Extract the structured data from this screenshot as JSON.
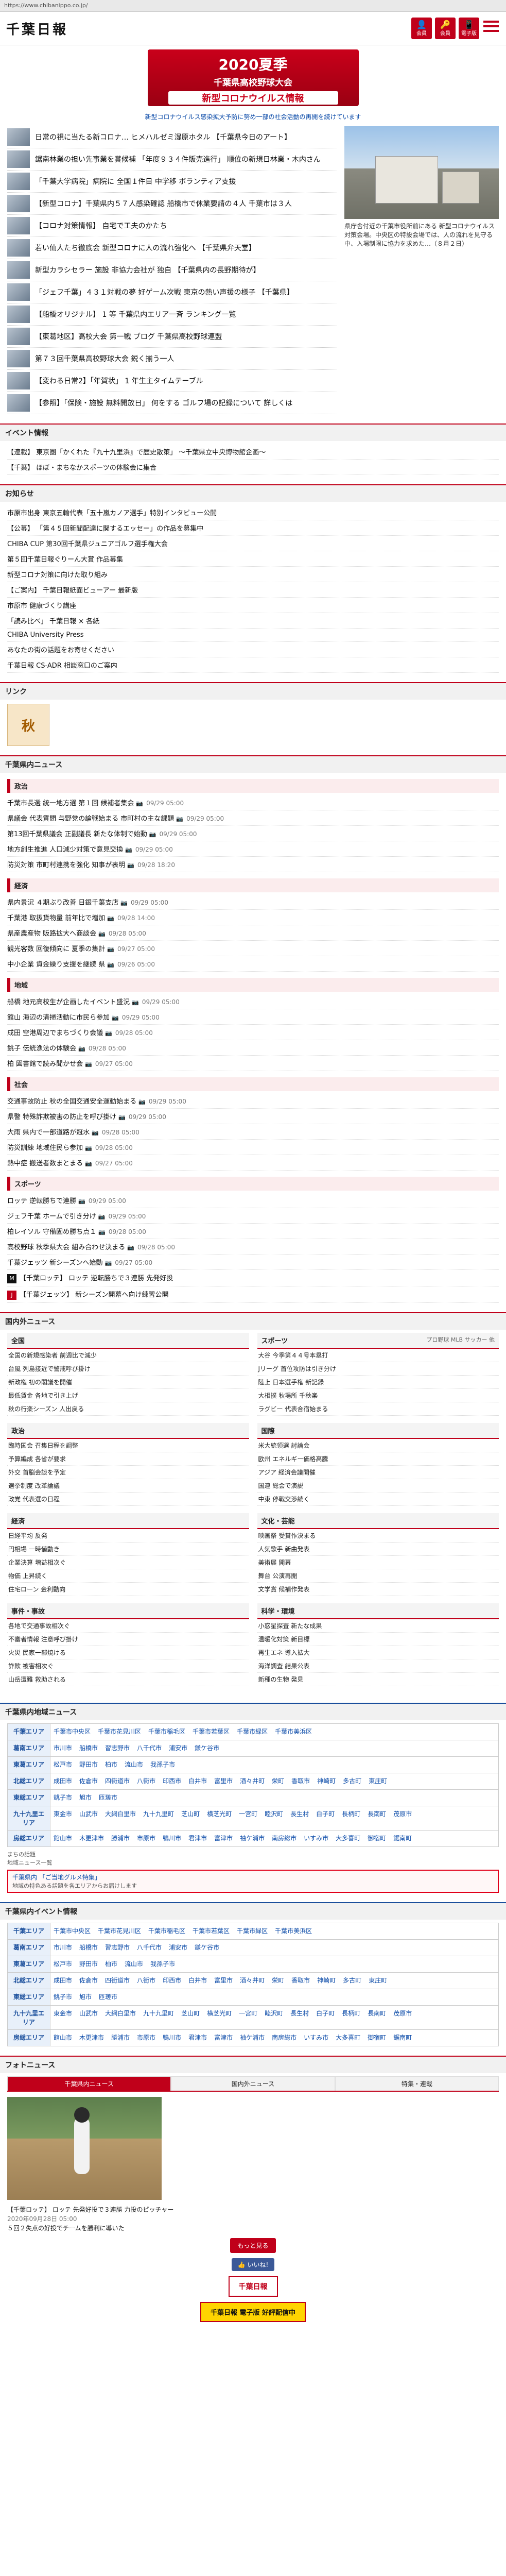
{
  "url": "https://www.chibanippo.co.jp/",
  "header": {
    "logo": "千葉日報",
    "icons": [
      {
        "label": "会員",
        "glyph": "👤",
        "color": "#c0001a"
      },
      {
        "label": "会員",
        "glyph": "🔑",
        "color": "#c0001a"
      },
      {
        "label": "電子版",
        "glyph": "📱",
        "color": "#c0001a"
      }
    ]
  },
  "banner": {
    "line1": "2020夏季",
    "line2": "千葉県高校野球大会",
    "line3": "新型コロナウイルス情報"
  },
  "notice": "新型コロナウイルス感染拡大予防に努め一部の社会活動の再開を続けています",
  "top_news": [
    "日常の視に当たる新コロナ… ヒメハルゼミ湿原ホタル 【千葉県今日のアート】",
    "鋸南林業の担い先事業を賞候補 「年度９３４件販売進行」 順位の新規日林業・木内さん",
    "「千葉大学病院」病院に 全国１件目 中学移 ボランティア支援",
    "【新型コロナ】千葉県内５７人感染確認 船橋市で休業要請の４人 千葉市は３人",
    "【コロナ対策情報】 自宅で工夫のかたち",
    "若い仙人たち徹底会 新型コロナに人の流れ強化へ 【千葉県弁天堂】",
    "新型カラシセラー 施設 非協力会社が 独自 【千葉県内の長野期待が】",
    "「ジェフ千葉」４３１対戦の夢 好ゲーム次戦 東京の熱い声援の様子 【千葉県】",
    "【船橋オリジナル】 1 等 千葉県内エリア一斉 ランキング一覧",
    "【東葛地区】高校大会 第一戦 ブログ 千葉県高校野球連盟",
    "第７３回千葉県高校野球大会 鋭く揃う一人",
    "【変わる日常2】「年賀状」 1 年生主タイムテーブル",
    "【参照】「保険・施設 無料開放日」 何をする ゴルフ場の記録について 詳しくは"
  ],
  "top_photo_caption": "県庁舎付近の千葉市役所前にある 新型コロナウイルス対策会場。中央区の特設会場では、人の流れを見守る中、入場制限に協力を求めた…（８月２日）",
  "sections": {
    "events_title": "イベント情報",
    "events": [
      "【連載】 東京圏「かくれた『九十九里浜』で歴史散策」 〜千葉県立中央博物館企画〜",
      "【千葉】 ほぼ・まちなかスポーツの体験会に集合"
    ],
    "oshirase_title": "お知らせ",
    "oshirase": [
      "市原市出身 東京五輪代表「五十嵐カノア選手」特別インタビュー公開",
      "【公募】 「第４５回新聞配達に関するエッセー」の作品を募集中",
      "CHIBA CUP 第30回千葉県ジュニアゴルフ選手権大会",
      "第５回千葉日報ぐりーん大賞 作品募集",
      "新型コロナ対策に向けた取り組み",
      "【ご案内】 千葉日報紙面ビューアー 最新版",
      "市原市 健康づくり講座",
      "「読み比べ」 千葉日報 × 各紙",
      "CHIBA University Press",
      "あなたの街の話題をお寄せください",
      "千葉日報 CS-ADR 相談窓口のご案内"
    ],
    "links_title": "リンク",
    "links_ad_text": "秋",
    "local_news_title": "千葉県内ニュース",
    "categories": [
      {
        "name": "政治",
        "items": [
          {
            "t": "千葉市長選 統一地方選 第１回 候補者集会",
            "d": "09/29 05:00"
          },
          {
            "t": "県議会 代表質問 与野党の論戦始まる 市町村の主な課題",
            "d": "09/29 05:00"
          },
          {
            "t": "第13回千葉県議会 正副議長 新たな体制で始動",
            "d": "09/29 05:00"
          },
          {
            "t": "地方創生推進 人口減少対策で意見交換",
            "d": "09/29 05:00"
          },
          {
            "t": "防災対策 市町村連携を強化 知事が表明",
            "d": "09/28 18:20"
          }
        ]
      },
      {
        "name": "経済",
        "items": [
          {
            "t": "県内景況 ４期ぶり改善 日銀千葉支店",
            "d": "09/29 05:00"
          },
          {
            "t": "千葉港 取扱貨物量 前年比で増加",
            "d": "09/28 14:00"
          },
          {
            "t": "県産農産物 販路拡大へ商談会",
            "d": "09/28 05:00"
          },
          {
            "t": "観光客数 回復傾向に 夏季の集計",
            "d": "09/27 05:00"
          },
          {
            "t": "中小企業 資金繰り支援を継続 県",
            "d": "09/26 05:00"
          }
        ]
      },
      {
        "name": "地域",
        "items": [
          {
            "t": "船橋 地元高校生が企画したイベント盛況",
            "d": "09/29 05:00"
          },
          {
            "t": "館山 海辺の清掃活動に市民ら参加",
            "d": "09/29 05:00"
          },
          {
            "t": "成田 空港周辺でまちづくり会議",
            "d": "09/28 05:00"
          },
          {
            "t": "銚子 伝統漁法の体験会",
            "d": "09/28 05:00"
          },
          {
            "t": "柏 図書館で読み聞かせ会",
            "d": "09/27 05:00"
          }
        ]
      },
      {
        "name": "社会",
        "items": [
          {
            "t": "交通事故防止 秋の全国交通安全運動始まる",
            "d": "09/29 05:00"
          },
          {
            "t": "県警 特殊詐欺被害の防止を呼び掛け",
            "d": "09/29 05:00"
          },
          {
            "t": "大雨 県内で一部道路が冠水",
            "d": "09/28 05:00"
          },
          {
            "t": "防災訓練 地域住民ら参加",
            "d": "09/28 05:00"
          },
          {
            "t": "熱中症 搬送者数まとまる",
            "d": "09/27 05:00"
          }
        ]
      },
      {
        "name": "スポーツ",
        "items": [
          {
            "t": "ロッテ 逆転勝ちで連勝",
            "d": "09/29 05:00"
          },
          {
            "t": "ジェフ千葉 ホームで引き分け",
            "d": "09/29 05:00"
          },
          {
            "t": "柏レイソル 守備固め勝ち点１",
            "d": "09/28 05:00"
          },
          {
            "t": "高校野球 秋季県大会 組み合わせ決まる",
            "d": "09/28 05:00"
          },
          {
            "t": "千葉ジェッツ 新シーズンへ始動",
            "d": "09/27 05:00"
          }
        ]
      }
    ],
    "marines_text": "【千葉ロッテ】 ロッテ 逆転勝ちで３連勝 先発好投",
    "jets_text": "【千葉ジェッツ】 新シーズン開幕へ向け練習公開"
  },
  "national_news_title": "国内外ニュース",
  "national_columns": [
    {
      "left": {
        "title": "全国",
        "sub": "",
        "items": [
          "全国の新規感染者 前週比で減少",
          "台風 列島接近で警戒呼び掛け",
          "新政権 初の閣議を開催",
          "最低賃金 各地で引き上げ",
          "秋の行楽シーズン 人出戻る"
        ]
      },
      "right": {
        "title": "スポーツ",
        "sub": "プロ野球 MLB サッカー 他",
        "items": [
          "大谷 今季第４４号本塁打",
          "Jリーグ 首位攻防は引き分け",
          "陸上 日本選手権 新記録",
          "大相撲 秋場所 千秋楽",
          "ラグビー 代表合宿始まる"
        ]
      }
    },
    {
      "left": {
        "title": "政治",
        "sub": "",
        "items": [
          "臨時国会 召集日程を調整",
          "予算編成 各省が要求",
          "外交 首脳会談を予定",
          "選挙制度 改革論議",
          "政党 代表選の日程"
        ]
      },
      "right": {
        "title": "国際",
        "sub": "",
        "items": [
          "米大統領選 討論会",
          "欧州 エネルギー価格高騰",
          "アジア 経済会議開催",
          "国連 総会で演説",
          "中東 停戦交渉続く"
        ]
      }
    },
    {
      "left": {
        "title": "経済",
        "sub": "",
        "items": [
          "日経平均 反発",
          "円相場 一時値動き",
          "企業決算 増益相次ぐ",
          "物価 上昇続く",
          "住宅ローン 金利動向"
        ]
      },
      "right": {
        "title": "文化・芸能",
        "sub": "",
        "items": [
          "映画祭 受賞作決まる",
          "人気歌手 新曲発表",
          "美術展 開幕",
          "舞台 公演再開",
          "文学賞 候補作発表"
        ]
      }
    },
    {
      "left": {
        "title": "事件・事故",
        "sub": "",
        "items": [
          "各地で交通事故相次ぐ",
          "不審者情報 注意呼び掛け",
          "火災 民家一部焼ける",
          "詐欺 被害相次ぐ",
          "山岳遭難 救助される"
        ]
      },
      "right": {
        "title": "科学・環境",
        "sub": "",
        "items": [
          "小惑星探査 新たな成果",
          "温暖化対策 新目標",
          "再生エネ 導入拡大",
          "海洋調査 結果公表",
          "新種の生物 発見"
        ]
      }
    }
  ],
  "area_news_title": "千葉県内地域ニュース",
  "areas": [
    {
      "name": "千葉エリア",
      "cities": [
        "千葉市中央区",
        "千葉市花見川区",
        "千葉市稲毛区",
        "千葉市若葉区",
        "千葉市緑区",
        "千葉市美浜区"
      ]
    },
    {
      "name": "葛南エリア",
      "cities": [
        "市川市",
        "船橋市",
        "習志野市",
        "八千代市",
        "浦安市",
        "鎌ケ谷市"
      ]
    },
    {
      "name": "東葛エリア",
      "cities": [
        "松戸市",
        "野田市",
        "柏市",
        "流山市",
        "我孫子市"
      ]
    },
    {
      "name": "北総エリア",
      "cities": [
        "成田市",
        "佐倉市",
        "四街道市",
        "八街市",
        "印西市",
        "白井市",
        "富里市",
        "酒々井町",
        "栄町",
        "香取市",
        "神崎町",
        "多古町",
        "東庄町"
      ]
    },
    {
      "name": "東総エリア",
      "cities": [
        "銚子市",
        "旭市",
        "匝瑳市"
      ]
    },
    {
      "name": "九十九里エリア",
      "cities": [
        "東金市",
        "山武市",
        "大網白里市",
        "九十九里町",
        "芝山町",
        "横芝光町",
        "一宮町",
        "睦沢町",
        "長生村",
        "白子町",
        "長柄町",
        "長南町",
        "茂原市"
      ]
    },
    {
      "name": "房総エリア",
      "cities": [
        "館山市",
        "木更津市",
        "勝浦市",
        "市原市",
        "鴨川市",
        "君津市",
        "富津市",
        "袖ケ浦市",
        "南房総市",
        "いすみ市",
        "大多喜町",
        "御宿町",
        "鋸南町"
      ]
    }
  ],
  "area_notes": [
    "まちの話題",
    "地域ニュース一覧"
  ],
  "highlight_note": "千葉県内 「ご当地グルメ特集」",
  "highlight_sub": "地域の特色ある話題を各エリアからお届けします",
  "area_event_title": "千葉県内イベント情報",
  "photo_news_title": "フォトニュース",
  "photo_tabs": [
    {
      "label": "千葉県内ニュース",
      "active": true
    },
    {
      "label": "国内外ニュース",
      "active": false
    },
    {
      "label": "特集・連載",
      "active": false
    }
  ],
  "photo_main_caption": "【千葉ロッテ】 ロッテ 先発好投で３連勝 力投のピッチャー",
  "photo_main_date": "2020年09月28日 05:00",
  "photo_main_sub": "５回２失点の好投でチームを勝利に導いた",
  "btn_more": "もっと見る",
  "fb_label": "いいね!",
  "footer_logo": "千葉日報",
  "footer_ad": "千葉日報 電子版 好評配信中"
}
